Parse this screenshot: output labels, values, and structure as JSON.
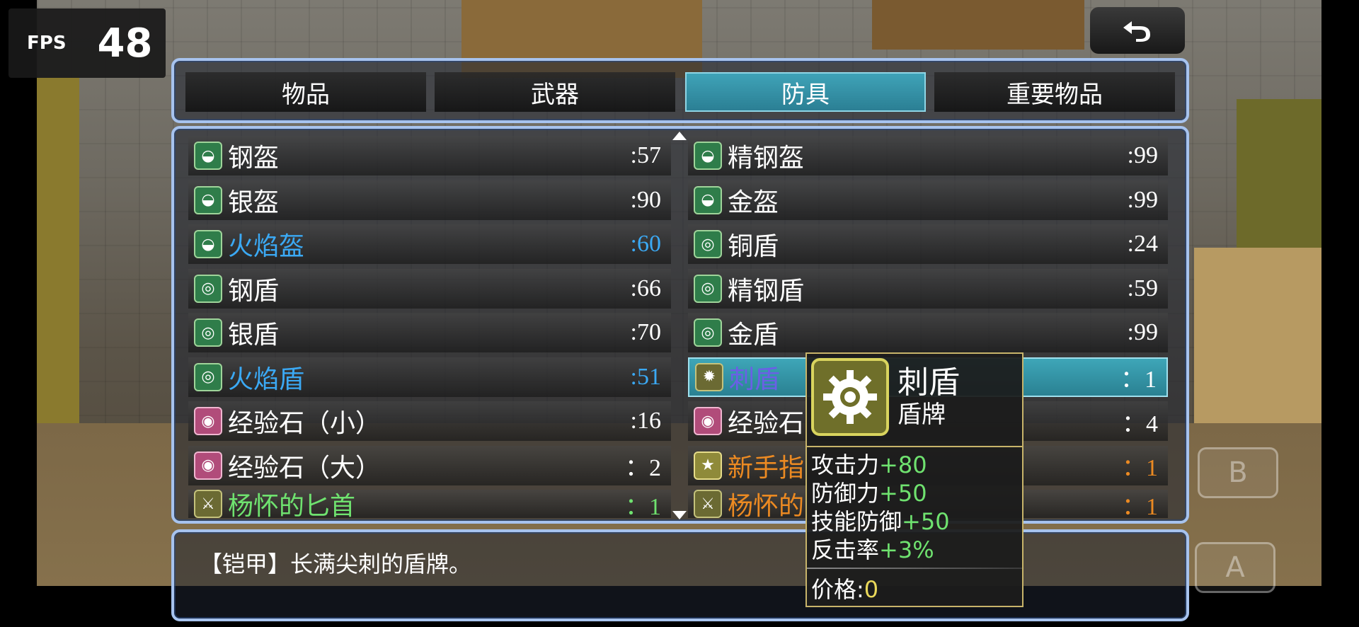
{
  "fps": {
    "label": "FPS",
    "value": "48"
  },
  "tabs": [
    {
      "label": "物品",
      "active": false
    },
    {
      "label": "武器",
      "active": false
    },
    {
      "label": "防具",
      "active": true
    },
    {
      "label": "重要物品",
      "active": false
    }
  ],
  "items_left": [
    {
      "name": "钢盔",
      "count": ":57",
      "icon": "helmet-icon",
      "color": "white"
    },
    {
      "name": "银盔",
      "count": ":90",
      "icon": "helmet-icon",
      "color": "white"
    },
    {
      "name": "火焰盔",
      "count": ":60",
      "icon": "fire-helmet-icon",
      "color": "blue"
    },
    {
      "name": "钢盾",
      "count": ":66",
      "icon": "shield-icon",
      "color": "white"
    },
    {
      "name": "银盾",
      "count": ":70",
      "icon": "shield-icon",
      "color": "white"
    },
    {
      "name": "火焰盾",
      "count": ":51",
      "icon": "shield-icon",
      "color": "blue"
    },
    {
      "name": "经验石（小）",
      "count": ":16",
      "icon": "exp-stone-icon",
      "color": "white"
    },
    {
      "name": "经验石（大）",
      "count": "：2",
      "icon": "exp-stone-icon",
      "color": "white"
    },
    {
      "name": "杨怀的匕首",
      "count": "：1",
      "icon": "dagger-icon",
      "color": "green"
    }
  ],
  "items_right": [
    {
      "name": "精钢盔",
      "count": ":99",
      "icon": "helmet-icon",
      "color": "white"
    },
    {
      "name": "金盔",
      "count": ":99",
      "icon": "helmet-icon",
      "color": "white"
    },
    {
      "name": "铜盾",
      "count": ":24",
      "icon": "shield-icon",
      "color": "white"
    },
    {
      "name": "精钢盾",
      "count": ":59",
      "icon": "shield-icon",
      "color": "white"
    },
    {
      "name": "金盾",
      "count": ":99",
      "icon": "shield-icon",
      "color": "white"
    },
    {
      "name": "刺盾",
      "count": "：1",
      "icon": "spike-shield-icon",
      "color": "selected"
    },
    {
      "name": "经验石",
      "count": "：4",
      "icon": "exp-stone-icon",
      "color": "white"
    },
    {
      "name": "新手指",
      "count": "：1",
      "icon": "star-icon",
      "color": "orange"
    },
    {
      "name": "杨怀的",
      "count": "：1",
      "icon": "dagger-icon",
      "color": "orange"
    }
  ],
  "description": "【铠甲】长满尖刺的盾牌。",
  "tooltip": {
    "name": "刺盾",
    "type": "盾牌",
    "stats": [
      {
        "label": "攻击力",
        "value": "+80"
      },
      {
        "label": "防御力",
        "value": "+50"
      },
      {
        "label": "技能防御",
        "value": "+50"
      },
      {
        "label": "反击率",
        "value": "+3%"
      }
    ],
    "price_label": "价格:",
    "price_value": "0"
  },
  "buttons": {
    "b_label": "B",
    "a_label": "A"
  },
  "colors": {
    "accent": "#3ea6b8",
    "window_border": "#a7c3ee",
    "stat_green": "#6fe26f",
    "price_yellow": "#e9d85a"
  }
}
